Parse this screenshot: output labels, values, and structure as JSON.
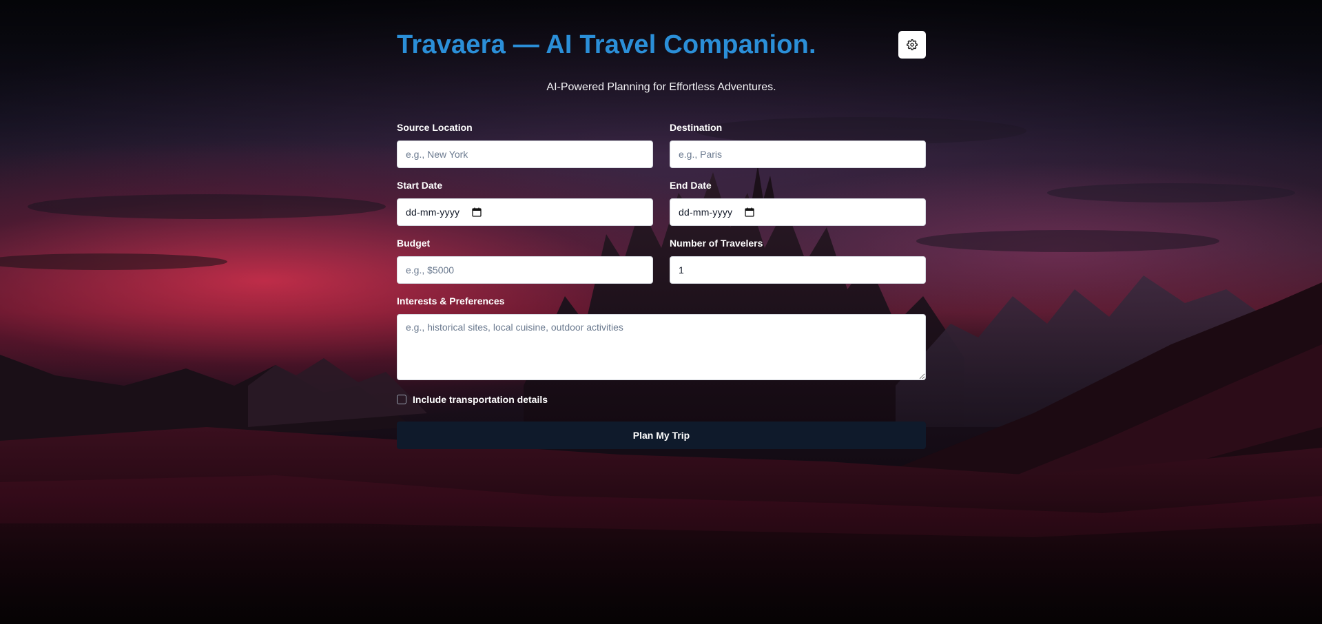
{
  "header": {
    "title": "Travaera — AI Travel Companion.",
    "subtitle": "AI-Powered Planning for Effortless Adventures.",
    "settings_icon": "gear-icon"
  },
  "form": {
    "source": {
      "label": "Source Location",
      "placeholder": "e.g., New York",
      "value": ""
    },
    "destination": {
      "label": "Destination",
      "placeholder": "e.g., Paris",
      "value": ""
    },
    "start_date": {
      "label": "Start Date",
      "display": "dd-mm-yyyy",
      "icon": "calendar-icon"
    },
    "end_date": {
      "label": "End Date",
      "display": "dd-mm-yyyy",
      "icon": "calendar-icon"
    },
    "budget": {
      "label": "Budget",
      "placeholder": "e.g., $5000",
      "value": ""
    },
    "travelers": {
      "label": "Number of Travelers",
      "value": "1"
    },
    "interests": {
      "label": "Interests & Preferences",
      "placeholder": "e.g., historical sites, local cuisine, outdoor activities",
      "value": ""
    },
    "transportation": {
      "label": "Include transportation details",
      "checked": false
    },
    "submit_label": "Plan My Trip"
  },
  "colors": {
    "title": "#2b8fd8",
    "button_bg": "#0f1a2b",
    "input_bg": "#ffffff",
    "placeholder": "#6b7a8f"
  }
}
